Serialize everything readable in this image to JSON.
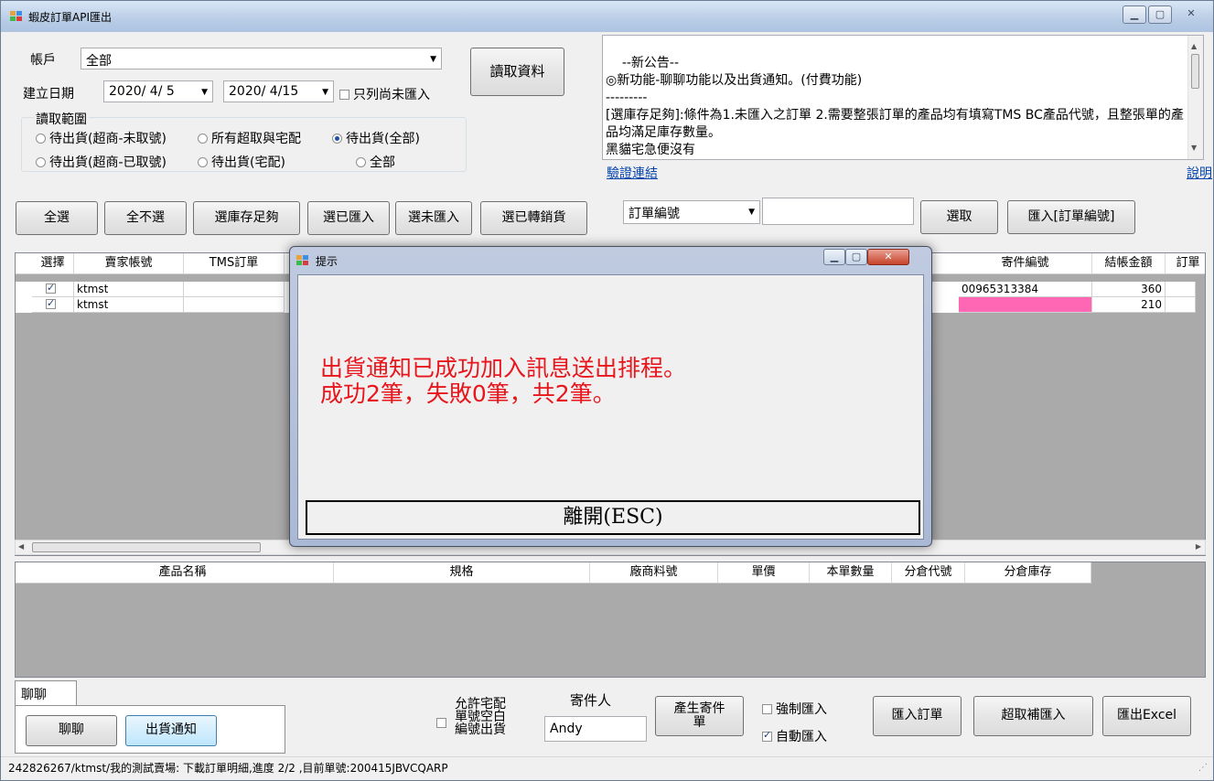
{
  "window": {
    "title": "蝦皮訂單API匯出"
  },
  "filters": {
    "account_label": "帳戶",
    "account_value": "全部",
    "date_label": "建立日期",
    "date_from": "2020/ 4/ 5",
    "date_to": "2020/ 4/15",
    "only_not_imported_label": "只列尚未匯入",
    "read_button": "讀取資料",
    "range_label": "讀取範圍",
    "range_options": [
      "待出貨(超商-未取號)",
      "所有超取與宅配",
      "待出貨(全部)",
      "待出貨(超商-已取號)",
      "待出貨(宅配)",
      "全部"
    ],
    "range_selected": "待出貨(全部)"
  },
  "notice": {
    "text": "--新公告--\n◎新功能-聊聊功能以及出貨通知。(付費功能)\n---------\n[選庫存足夠]:條件為1.未匯入之訂單 2.需要整張訂單的產品均有填寫TMS BC產品代號，且整張單的產品均滿足庫存數量。\n黑貓宅急便沒有",
    "verify_link": "驗證連結",
    "help_link": "說明"
  },
  "selection_buttons": {
    "select_all": "全選",
    "select_none": "全不選",
    "select_stock_enough": "選庫存足夠",
    "select_imported": "選已匯入",
    "select_not_imported": "選未匯入",
    "select_transferred": "選已轉銷貨"
  },
  "lookup": {
    "field_select": "訂單編號",
    "field_value": "",
    "pick_button": "選取",
    "import_button": "匯入[訂單編號]"
  },
  "orders_table": {
    "columns": [
      "選擇",
      "賣家帳號",
      "TMS訂單",
      "寄件編號",
      "結帳金額",
      "訂單"
    ],
    "rows": [
      {
        "checked": true,
        "seller": "ktmst",
        "tms": "",
        "ship_no": "00965313384",
        "amount": "360",
        "highlight": false
      },
      {
        "checked": true,
        "seller": "ktmst",
        "tms": "",
        "ship_no": "",
        "amount": "210",
        "highlight": true
      }
    ]
  },
  "products_table": {
    "columns": [
      "產品名稱",
      "規格",
      "廠商料號",
      "單價",
      "本單數量",
      "分倉代號",
      "分倉庫存"
    ]
  },
  "bottom": {
    "tab_label": "聊聊",
    "chat_button": "聊聊",
    "ship_notice_button": "出貨通知",
    "allow_home_delivery_label": "允許宅配\n單號空白\n編號出貨",
    "sender_label": "寄件人",
    "sender_value": "Andy",
    "gen_sender_button": "產生寄件\n單",
    "force_import_label": "強制匯入",
    "auto_import_label": "自動匯入",
    "import_orders_button": "匯入訂單",
    "pickup_reimport_button": "超取補匯入",
    "export_excel_button": "匯出Excel"
  },
  "status": {
    "text": "242826267/ktmst/我的測試賣場: 下載訂單明細,進度 2/2 ,目前單號:200415JBVCQARP"
  },
  "dialog": {
    "title": "提示",
    "message_line1": "出貨通知已成功加入訊息送出排程。",
    "message_line2": "成功2筆，失敗0筆，共2筆。",
    "close_button": "離開(ESC)"
  },
  "colors": {
    "highlight_cell": "#ff66b3",
    "message": "#e8161c",
    "grid_background": "#aaaaaa"
  }
}
